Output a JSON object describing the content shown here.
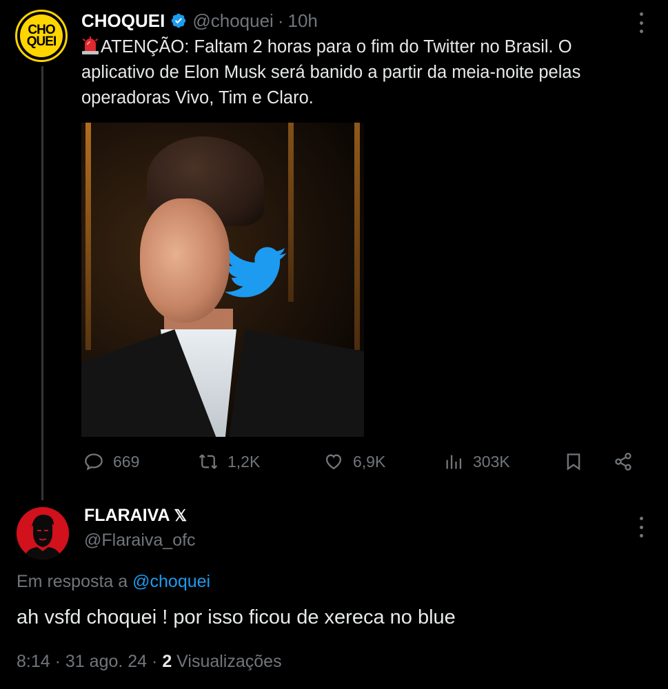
{
  "tweet": {
    "avatar_text_line1": "CHO",
    "avatar_text_line2": "QUEI",
    "name": "CHOQUEI",
    "handle": "@choquei",
    "separator": "·",
    "time": "10h",
    "text": "ATENÇÃO: Faltam 2 horas para o fim do Twitter no Brasil. O aplicativo de Elon Musk será banido a partir da meia-noite pelas operadoras Vivo, Tim e Claro.",
    "emoji_icon": "police-siren-icon",
    "actions": {
      "replies": "669",
      "retweets": "1,2K",
      "likes": "6,9K",
      "views": "303K"
    }
  },
  "reply": {
    "name": "FLARAIVA",
    "badge": "𝕏",
    "handle": "@Flaraiva_ofc",
    "in_reply_to_label": "Em resposta a",
    "in_reply_to_mention": "@choquei",
    "text": "ah vsfd choquei ! por isso ficou de xereca no blue",
    "time": "8:14",
    "sep1": "·",
    "date": "31 ago. 24",
    "sep2": "·",
    "views_count": "2",
    "views_label": "Visualizações"
  },
  "colors": {
    "background": "#000000",
    "text": "#e7e9ea",
    "muted": "#71767b",
    "link": "#1d9bf0",
    "choquei_yellow": "#ffd500",
    "flaraiva_red": "#d1111b"
  }
}
